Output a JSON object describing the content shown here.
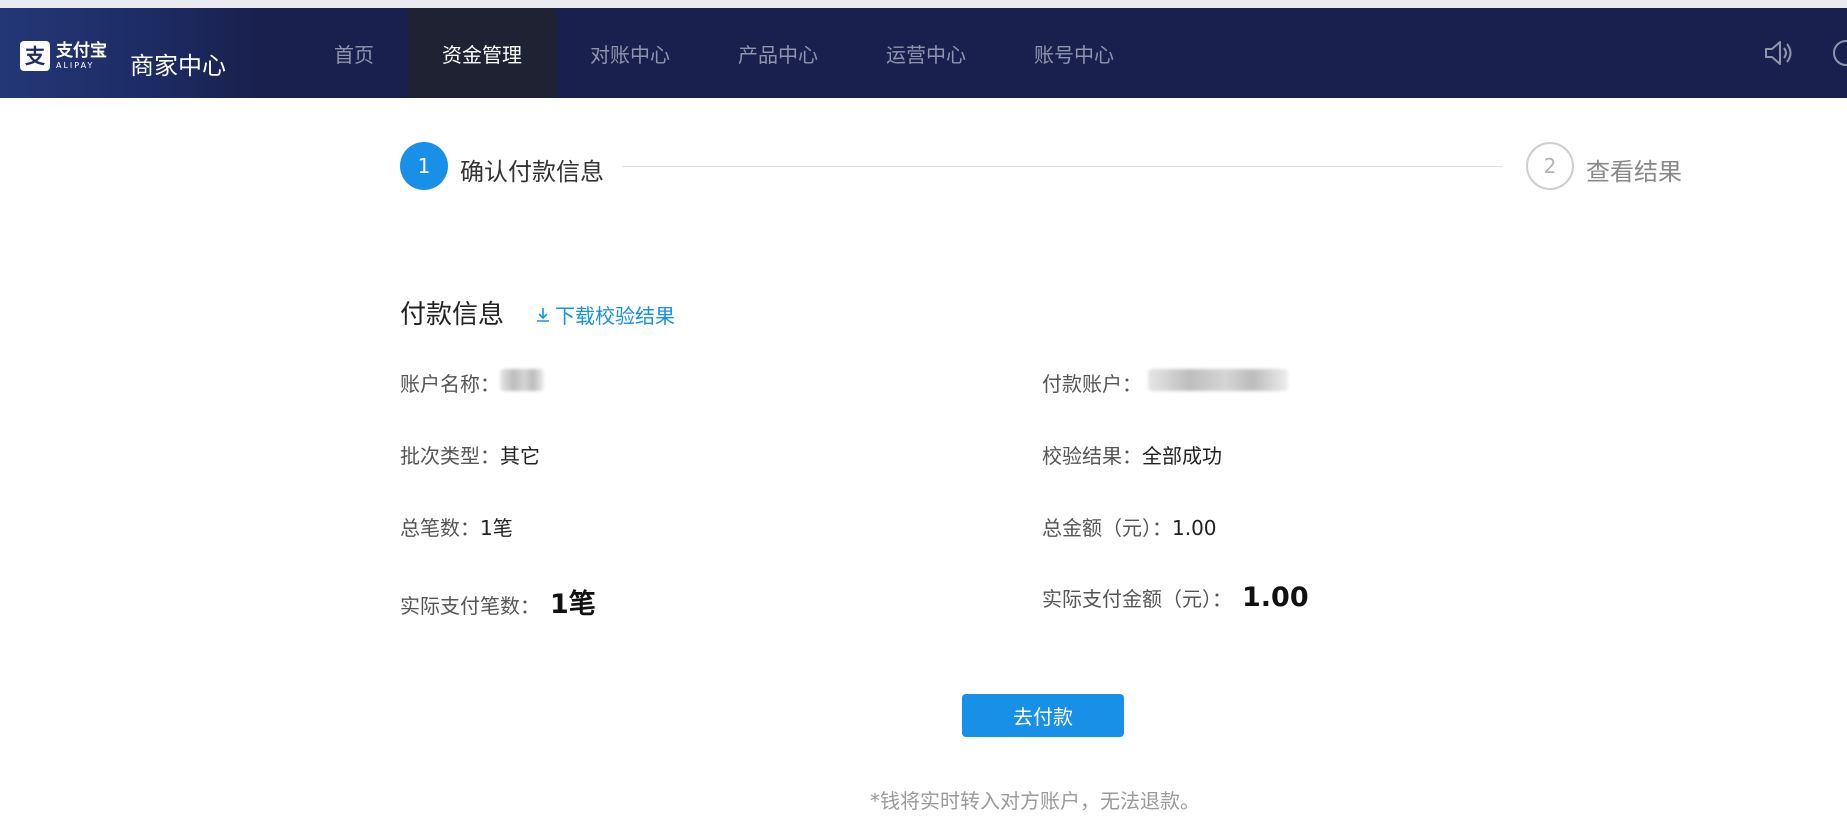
{
  "header": {
    "logo_mark": "支",
    "logo_cn": "支付宝",
    "logo_en": "ALIPAY",
    "title": "商家中心",
    "nav": [
      {
        "label": "首页"
      },
      {
        "label": "资金管理",
        "active": true
      },
      {
        "label": "对账中心"
      },
      {
        "label": "产品中心"
      },
      {
        "label": "运营中心"
      },
      {
        "label": "账号中心"
      }
    ],
    "icons": [
      "speaker-icon",
      "help-icon"
    ]
  },
  "steps": {
    "step1": {
      "number": "1",
      "label": "确认付款信息"
    },
    "step2": {
      "number": "2",
      "label": "查看结果"
    }
  },
  "section": {
    "title": "付款信息",
    "download_label": "下载校验结果"
  },
  "fields": {
    "account_name_label": "账户名称：",
    "payer_account_label": "付款账户：",
    "batch_type_label": "批次类型：",
    "batch_type_value": "其它",
    "check_result_label": "校验结果：",
    "check_result_value": "全部成功",
    "total_count_label": "总笔数：",
    "total_count_value": "1笔",
    "total_amount_label": "总金额（元）：",
    "total_amount_value": "1.00",
    "actual_count_label": "实际支付笔数：",
    "actual_count_value": "1笔",
    "actual_amount_label": "实际支付金额（元）：",
    "actual_amount_value": "1.00"
  },
  "actions": {
    "pay_button": "去付款",
    "notice": "*钱将实时转入对方账户，无法退款。"
  },
  "colors": {
    "nav_bg": "#19204d",
    "accent": "#1890e8"
  }
}
